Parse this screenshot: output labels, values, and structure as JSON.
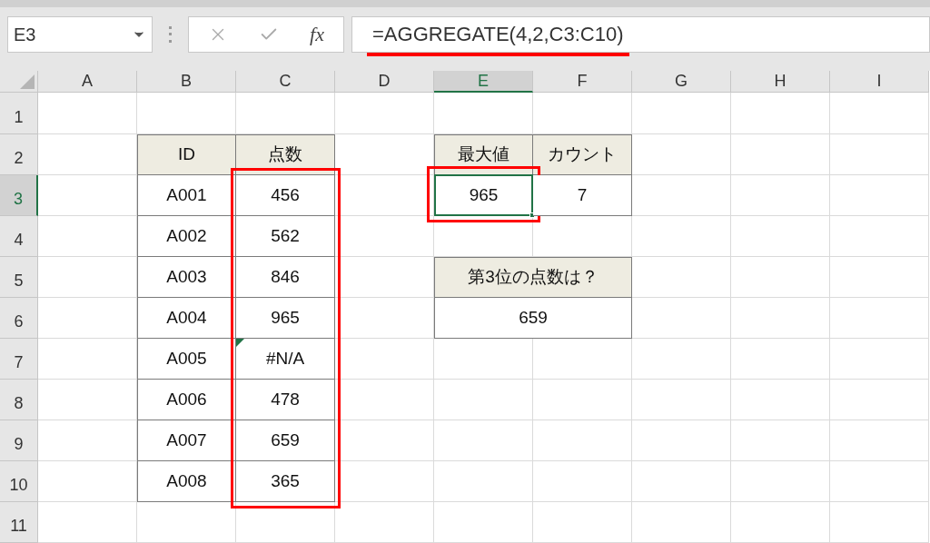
{
  "name_box": {
    "value": "E3"
  },
  "formula_bar": {
    "function_label": "fx",
    "formula": "=AGGREGATE(4,2,C3:C10)",
    "underlined": true
  },
  "columns": [
    {
      "label": "A",
      "selected": false
    },
    {
      "label": "B",
      "selected": false
    },
    {
      "label": "C",
      "selected": false
    },
    {
      "label": "D",
      "selected": false
    },
    {
      "label": "E",
      "selected": true
    },
    {
      "label": "F",
      "selected": false
    },
    {
      "label": "G",
      "selected": false
    },
    {
      "label": "H",
      "selected": false
    },
    {
      "label": "I",
      "selected": false
    }
  ],
  "rows": [
    {
      "label": "1",
      "selected": false
    },
    {
      "label": "2",
      "selected": false
    },
    {
      "label": "3",
      "selected": true
    },
    {
      "label": "4",
      "selected": false
    },
    {
      "label": "5",
      "selected": false
    },
    {
      "label": "6",
      "selected": false
    },
    {
      "label": "7",
      "selected": false
    },
    {
      "label": "8",
      "selected": false
    },
    {
      "label": "9",
      "selected": false
    },
    {
      "label": "10",
      "selected": false
    },
    {
      "label": "11",
      "selected": false
    }
  ],
  "score_table": {
    "headers": [
      "ID",
      "点数"
    ],
    "scores_highlighted": true,
    "rows": [
      {
        "id": "A001",
        "score": "456",
        "error_flag": false
      },
      {
        "id": "A002",
        "score": "562",
        "error_flag": false
      },
      {
        "id": "A003",
        "score": "846",
        "error_flag": false
      },
      {
        "id": "A004",
        "score": "965",
        "error_flag": false
      },
      {
        "id": "A005",
        "score": "#N/A",
        "error_flag": true
      },
      {
        "id": "A006",
        "score": "478",
        "error_flag": false
      },
      {
        "id": "A007",
        "score": "659",
        "error_flag": false
      },
      {
        "id": "A008",
        "score": "365",
        "error_flag": false
      }
    ]
  },
  "summary_table": {
    "headers": [
      "最大値",
      "カウント"
    ],
    "values": [
      {
        "text": "965",
        "selected": true,
        "highlighted": true
      },
      {
        "text": "7",
        "selected": false,
        "highlighted": false
      }
    ]
  },
  "question_table": {
    "header": "第3位の点数は？",
    "answer": "659"
  }
}
